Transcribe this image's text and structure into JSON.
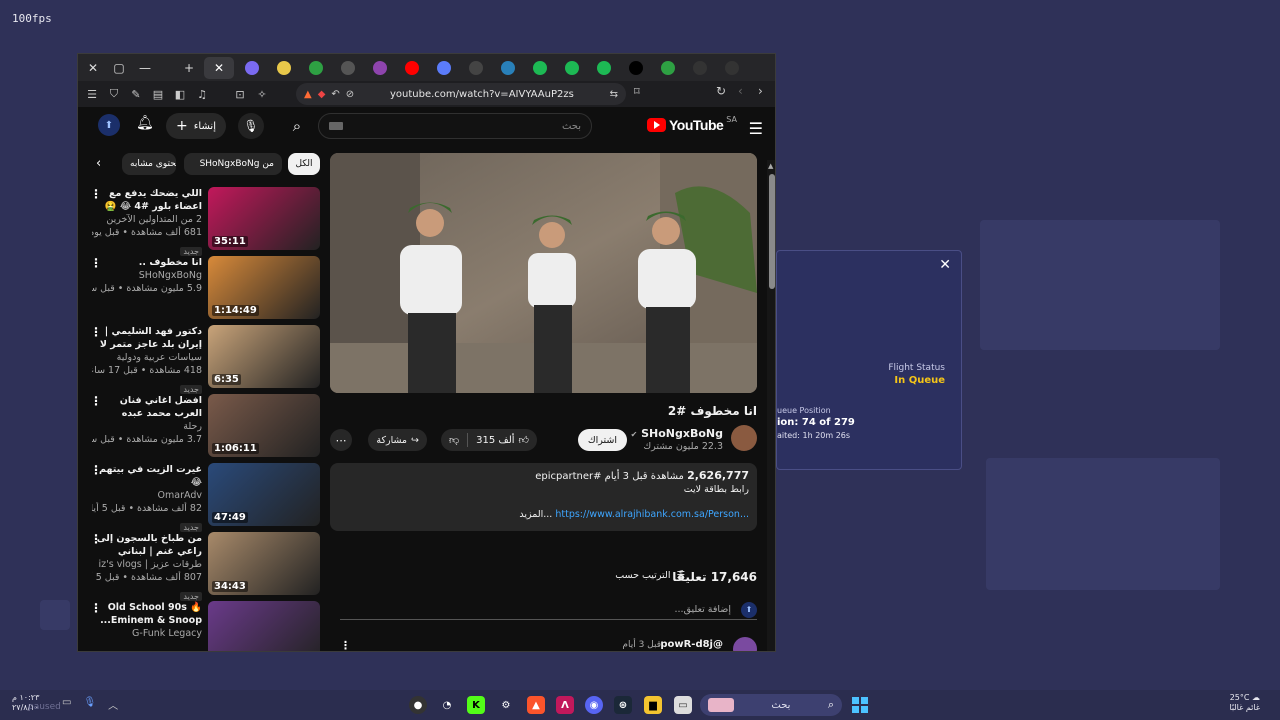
{
  "overlay": {
    "fps": "100fps"
  },
  "flight_popup": {
    "status_label": "Flight Status",
    "status_value": "In Queue",
    "queue_label": "ueue Position",
    "queue_position": "ion: 74 of 279",
    "waited": "aited: 1h 20m 26s"
  },
  "browser": {
    "url": "youtube.com/watch?v=AIVYAAuP2zs",
    "tab_favicons": [
      "#7a6af0",
      "#e8c84a",
      "#2ea043",
      "#555",
      "#8e44ad",
      "#ff0000",
      "#5b7cfa",
      "#444",
      "#2980b9",
      "#1db954",
      "#1db954",
      "#1db954",
      "#000",
      "#2ea043",
      "#333",
      "#333"
    ]
  },
  "youtube": {
    "logo": "YouTube",
    "country": "SA",
    "search_placeholder": "بحث",
    "create_label": "إنشاء",
    "chips": [
      "الكل",
      "من SHoNgxBoNg",
      "محتوى مشابه"
    ],
    "video": {
      "title": "انا مخطوف #2",
      "channel": "SHoNgxBoNg",
      "subscribers": "22.3 مليون مشترك",
      "subscribe_label": "اشتراك",
      "likes": "315 ألف",
      "share_label": "مشاركة",
      "views": "2,626,777",
      "views_suffix": "مشاهدة",
      "date": "قبل 3 أيام",
      "hashtag": "#epicpartner",
      "desc_line": "رابط بطاقة لايت",
      "more_label": "...المزيد",
      "link": "https://www.alrajhibank.com.sa/Person..."
    },
    "comments": {
      "count": "17,646 تعليقًا",
      "sort_label": "الترتيب حسب",
      "add_placeholder": "إضافة تعليق...",
      "first_author": "@powR-d8j",
      "first_time": "قبل 3 أيام"
    },
    "recommended": [
      {
        "title": "اللي يضحك يدفع مع اعضاء بلور #4 😂 🤮",
        "channel": "2 من المتداولين الآخرين",
        "stats": "681 ألف مشاهدة • قبل يوم ...",
        "badge": "جديد",
        "duration": "35:11"
      },
      {
        "title": "انا مخطوف ..",
        "channel": "SHoNgxBoNg",
        "stats": "5.9 مليون مشاهدة • قبل سنة...",
        "badge": "",
        "duration": "1:14:49"
      },
      {
        "title": "دكتور فهد الشليمي | إيران بلد عاجز متمر لا يستطيع...",
        "channel": "سياسات عربية ودولية",
        "stats": "418 مشاهدة • قبل 17 ساعة",
        "badge": "جديد",
        "duration": "6:35"
      },
      {
        "title": "افضل اغاني فنان العرب محمد عبده",
        "channel": "رحلة",
        "stats": "3.7 مليون مشاهدة • قبل سنتين",
        "badge": "",
        "duration": "1:06:11"
      },
      {
        "title": "غيرت الزيت في بيتهم 😂",
        "channel": "OmarAdv",
        "stats": "82 ألف مشاهدة • قبل 5 أيام",
        "badge": "جديد",
        "duration": "47:49"
      },
      {
        "title": "من طباخ بالسجون إلى راعي غنم | لبناني مواليد...",
        "channel": "طرقات عزيز | iz's vlogs",
        "stats": "807 ألف مشاهدة • قبل 5 أيام",
        "badge": "جديد",
        "duration": "34:43"
      },
      {
        "title": "Old School 90s 🔥 Eminem & Snoop...",
        "channel": "G-Funk Legacy",
        "stats": "",
        "badge": "",
        "duration": ""
      }
    ]
  },
  "taskbar": {
    "search_placeholder": "بحث",
    "clock_time": "١٠:٢٣ م",
    "clock_date": "٢٧/٨/١٠",
    "weather_temp": "25°C",
    "weather_desc": "غائم غالبًا",
    "paused_text": "paused"
  }
}
